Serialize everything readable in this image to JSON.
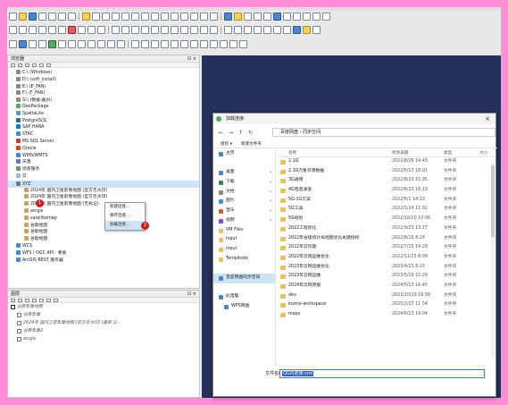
{
  "browser_panel": {
    "title": "浏览器",
    "items": [
      {
        "label": "C:\\ (Windows)",
        "icon": "drive-icon"
      },
      {
        "label": "D:\\ (soft_install)",
        "icon": "drive-icon"
      },
      {
        "label": "E:\\ (E_FAN)",
        "icon": "drive-icon"
      },
      {
        "label": "F:\\ (F_FAN)",
        "icon": "drive-icon"
      },
      {
        "label": "G:\\ (数据-备份)",
        "icon": "drive-icon"
      },
      {
        "label": "GeoPackage",
        "icon": "geopackage-icon"
      },
      {
        "label": "SpatiaLite",
        "icon": "spatialite-icon"
      },
      {
        "label": "PostgreSQL",
        "icon": "postgresql-icon"
      },
      {
        "label": "SAP HANA",
        "icon": "database-icon"
      },
      {
        "label": "STAC",
        "icon": "stac-icon"
      },
      {
        "label": "MS SQL Server",
        "icon": "database-icon"
      },
      {
        "label": "Oracle",
        "icon": "database-icon"
      },
      {
        "label": "WMS/WMTS",
        "icon": "globe-icon"
      },
      {
        "label": "矢量",
        "icon": "vector-icon"
      },
      {
        "label": "场景服务",
        "icon": "service-icon"
      },
      {
        "label": "云",
        "icon": "cloud-icon"
      },
      {
        "label": "XYZ",
        "icon": "xyz-icon"
      },
      {
        "label": "2024年 国内卫星影像地图 (官方无水印)",
        "icon": "tile-icon"
      },
      {
        "label": "2024年 国内卫星影像地图 (官方无水印)",
        "icon": "tile-icon"
      },
      {
        "label": "2024年 国内卫星影像地图 (无标记)",
        "icon": "tile-icon"
      },
      {
        "label": "arcgis",
        "icon": "tile-icon"
      },
      {
        "label": "satellitemap",
        "icon": "tile-icon"
      },
      {
        "label": "谷歌地图",
        "icon": "tile-icon"
      },
      {
        "label": "谷歌地图",
        "icon": "tile-icon"
      },
      {
        "label": "谷歌地图",
        "icon": "tile-icon"
      },
      {
        "label": "WCS",
        "icon": "globe-icon"
      },
      {
        "label": "WFS / OGC API - 要素",
        "icon": "globe-icon"
      },
      {
        "label": "ArcGIS REST 服务器",
        "icon": "globe-icon"
      }
    ]
  },
  "context_menu": {
    "items": [
      "新建连接...",
      "保存连接...",
      "加载连接..."
    ]
  },
  "layers_panel": {
    "title": "图层",
    "items": [
      {
        "label": "谷歌影像地图",
        "checked": true
      },
      {
        "label": "谷歌影像",
        "checked": false
      },
      {
        "label": "2024年 国内卫星影像地图 (官方无水印) (最新 1)",
        "checked": false
      },
      {
        "label": "谷歌影像2",
        "checked": false
      },
      {
        "label": "arcgis",
        "checked": false
      }
    ]
  },
  "badges": [
    "1",
    "2",
    "3"
  ],
  "dialog": {
    "title": "加载连接",
    "close": "×",
    "path": "百度网盘 › 同步空间",
    "commands": [
      "组织 ▾",
      "新建文件夹"
    ],
    "nav_items": [
      {
        "label": "主页",
        "pinned": false
      },
      {
        "label": "",
        "pinned": false
      },
      {
        "label": "桌面",
        "pinned": true
      },
      {
        "label": "下载",
        "pinned": true
      },
      {
        "label": "文档",
        "pinned": true
      },
      {
        "label": "图片",
        "pinned": true
      },
      {
        "label": "音乐",
        "pinned": true
      },
      {
        "label": "视频",
        "pinned": true
      },
      {
        "label": "VM Files",
        "pinned": false
      },
      {
        "label": "input",
        "pinned": false
      },
      {
        "label": "input",
        "pinned": false
      },
      {
        "label": "Templtodo",
        "pinned": false
      },
      {
        "label": "",
        "pinned": false
      },
      {
        "label": "百度网盘同步空间",
        "pinned": false
      },
      {
        "label": "",
        "pinned": false
      },
      {
        "label": "此电脑",
        "pinned": false
      },
      {
        "label": "WPS网盘",
        "pinned": false
      }
    ],
    "columns": [
      "名称",
      "修改日期",
      "类型",
      "大小"
    ],
    "files": [
      {
        "name": "2.1G",
        "date": "2022/8/26 14:43",
        "type": "文件夹"
      },
      {
        "name": "2.1G万象开源数据",
        "date": "2022/5/13 18:01",
        "type": "文件夹"
      },
      {
        "name": "3G通用",
        "date": "2022/8/23 15:35",
        "type": "文件夹"
      },
      {
        "name": "4G电音通道",
        "date": "2022/6/23 16:13",
        "type": "文件夹"
      },
      {
        "name": "5G-1G方案",
        "date": "2022/5/1 14:13",
        "type": "文件夹"
      },
      {
        "name": "5G工具",
        "date": "2022/1/14 11:02",
        "type": "文件夹"
      },
      {
        "name": "5G规划",
        "date": "2022/10/10 10:06",
        "type": "文件夹"
      },
      {
        "name": "2022工程优化",
        "date": "2022/9/23 13:27",
        "type": "文件夹"
      },
      {
        "name": "2022年省级统计局地图优化关键指标",
        "date": "2022/8/16 8:24",
        "type": "文件夹"
      },
      {
        "name": "2022年云问题",
        "date": "2022/7/15 14:29",
        "type": "文件夹"
      },
      {
        "name": "2022年云网运维优化",
        "date": "2022/11/15 8:09",
        "type": "文件夹"
      },
      {
        "name": "2023年云网运维优化",
        "date": "2023/4/23 8:25",
        "type": "文件夹"
      },
      {
        "name": "2023年云网运维",
        "date": "2023/5/19 15:29",
        "type": "文件夹"
      },
      {
        "name": "2024年云网周报",
        "date": "2024/5/13 16:45",
        "type": "文件夹"
      },
      {
        "name": "dev",
        "date": "2023/10/29 16:58",
        "type": "文件夹"
      },
      {
        "name": "knime-workspace",
        "date": "2025/2/27 11:54",
        "type": "文件夹"
      },
      {
        "name": "maps",
        "date": "2024/6/13 19:04",
        "type": "文件夹"
      }
    ],
    "filename_label": "文件名(N):",
    "filename_value": "QGIS连接.xml"
  },
  "colors": {
    "border": "#ff8ed8",
    "canvas": "#25315a",
    "badge": "#c62020",
    "selection": "#cfe4fb"
  }
}
